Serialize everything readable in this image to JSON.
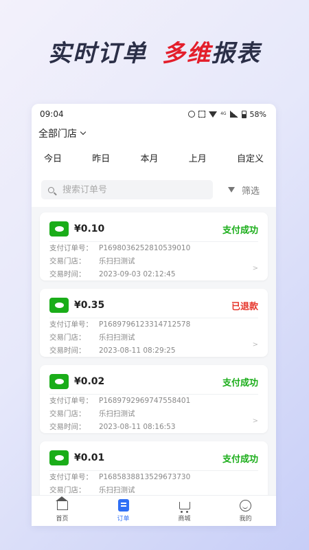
{
  "headline": {
    "part1": "实时订单",
    "part2": "多维",
    "part3": "报表"
  },
  "status_bar": {
    "time": "09:04",
    "network": "4G",
    "battery": "58%"
  },
  "store_selector": {
    "label": "全部门店"
  },
  "date_tabs": [
    "今日",
    "昨日",
    "本月",
    "上月",
    "自定义"
  ],
  "search": {
    "placeholder": "搜索订单号",
    "value": ""
  },
  "filter": {
    "label": "筛选"
  },
  "field_labels": {
    "order_no": "支付订单号：",
    "store": "交易门店：",
    "time": "交易时间："
  },
  "colors": {
    "success": "#1aad19",
    "refund": "#e6352b",
    "accent": "#2f6ff5"
  },
  "orders": [
    {
      "amount": "¥0.10",
      "status": "支付成功",
      "status_type": "success",
      "order_no": "P1698036252810539010",
      "store": "乐扫扫测试",
      "time": "2023-09-03 02:12:45"
    },
    {
      "amount": "¥0.35",
      "status": "已退款",
      "status_type": "refund",
      "order_no": "P1689796123314712578",
      "store": "乐扫扫测试",
      "time": "2023-08-11 08:29:25"
    },
    {
      "amount": "¥0.02",
      "status": "支付成功",
      "status_type": "success",
      "order_no": "P1689792969747558401",
      "store": "乐扫扫测试",
      "time": "2023-08-11 08:16:53"
    },
    {
      "amount": "¥0.01",
      "status": "支付成功",
      "status_type": "success",
      "order_no": "P1685838813529673730",
      "store": "乐扫扫测试",
      "time": ""
    }
  ],
  "tabbar": [
    {
      "label": "首页",
      "icon": "home-icon"
    },
    {
      "label": "订单",
      "icon": "order-icon"
    },
    {
      "label": "商城",
      "icon": "cart-icon"
    },
    {
      "label": "我的",
      "icon": "profile-icon"
    }
  ]
}
